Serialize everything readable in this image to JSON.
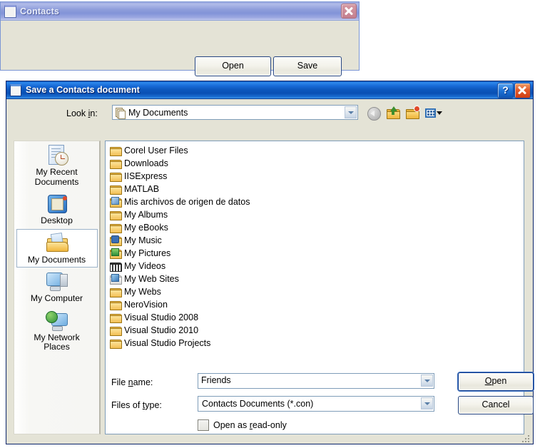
{
  "parent_window": {
    "title": "Contacts",
    "icon": "window-icon",
    "close_icon": "close-icon",
    "buttons": {
      "open": "Open",
      "save": "Save"
    }
  },
  "dialog": {
    "title": "Save a Contacts  document",
    "icon": "window-icon",
    "help_icon": "?",
    "close_icon": "close-icon",
    "lookin": {
      "label_pre": "Look ",
      "label_accel": "i",
      "label_post": "n:",
      "value": "My Documents",
      "icon": "my-documents-icon"
    },
    "toolbar": [
      {
        "name": "back-button",
        "tooltip": "Back"
      },
      {
        "name": "up-one-level-button",
        "tooltip": "Up One Level"
      },
      {
        "name": "create-new-folder-button",
        "tooltip": "Create New Folder"
      },
      {
        "name": "views-button",
        "tooltip": "Views"
      }
    ],
    "places": [
      {
        "name": "my-recent-documents",
        "label": "My Recent\nDocuments",
        "icon": "recent-documents-icon",
        "selected": false
      },
      {
        "name": "desktop",
        "label": "Desktop",
        "icon": "desktop-icon",
        "selected": false
      },
      {
        "name": "my-documents",
        "label": "My Documents",
        "icon": "my-documents-folder-icon",
        "selected": true
      },
      {
        "name": "my-computer",
        "label": "My Computer",
        "icon": "my-computer-icon",
        "selected": false
      },
      {
        "name": "my-network-places",
        "label": "My Network\nPlaces",
        "icon": "network-places-icon",
        "selected": false
      }
    ],
    "files": [
      {
        "name": "Corel User Files",
        "icon": "folder-icon"
      },
      {
        "name": "Downloads",
        "icon": "folder-icon"
      },
      {
        "name": "IISExpress",
        "icon": "folder-icon"
      },
      {
        "name": "MATLAB",
        "icon": "folder-icon"
      },
      {
        "name": "Mis archivos de origen de datos",
        "icon": "data-sources-folder-icon"
      },
      {
        "name": "My Albums",
        "icon": "folder-icon"
      },
      {
        "name": "My eBooks",
        "icon": "folder-icon"
      },
      {
        "name": "My Music",
        "icon": "music-folder-icon"
      },
      {
        "name": "My Pictures",
        "icon": "pictures-folder-icon"
      },
      {
        "name": "My Videos",
        "icon": "videos-folder-icon"
      },
      {
        "name": "My Web Sites",
        "icon": "web-sites-folder-icon"
      },
      {
        "name": "My Webs",
        "icon": "folder-icon"
      },
      {
        "name": "NeroVision",
        "icon": "folder-icon"
      },
      {
        "name": "Visual Studio 2008",
        "icon": "folder-icon"
      },
      {
        "name": "Visual Studio 2010",
        "icon": "folder-icon"
      },
      {
        "name": "Visual Studio Projects",
        "icon": "folder-icon"
      }
    ],
    "filename": {
      "label_pre": "File ",
      "label_accel": "n",
      "label_post": "ame:",
      "value": "Friends",
      "placeholder": ""
    },
    "filetype": {
      "label_pre": "Files of ",
      "label_accel": "t",
      "label_post": "ype:",
      "value": "Contacts Documents (*.con)"
    },
    "readonly": {
      "label_pre": "Open as ",
      "label_accel": "r",
      "label_post": "ead-only",
      "checked": false
    },
    "open_button": {
      "pre": "",
      "accel": "O",
      "post": "pen"
    },
    "cancel_button": "Cancel"
  },
  "colors": {
    "dialog_face": "#e4e3d6",
    "active_title": "#0a50b4",
    "inactive_title": "#8e9ddb",
    "field_border": "#7f9db9",
    "default_button_border": "#123d8c",
    "folder_yellow": "#f2bf54"
  }
}
